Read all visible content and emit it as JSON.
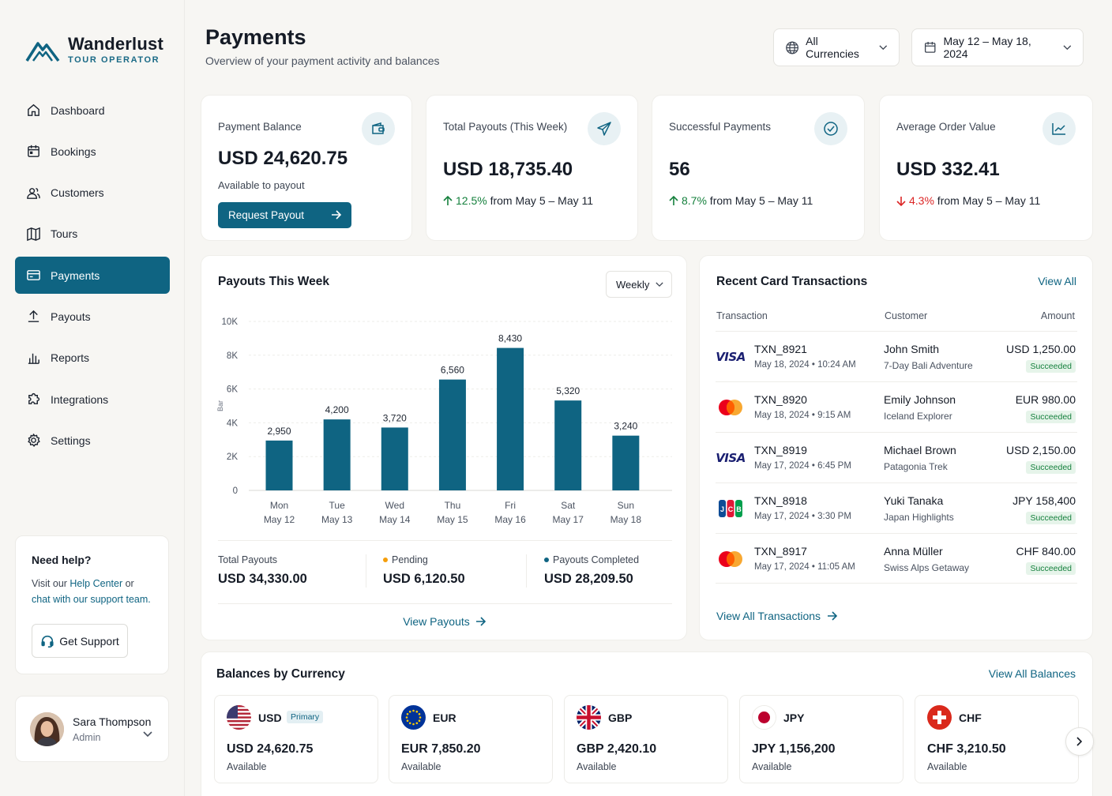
{
  "brand": {
    "name": "Wanderlust",
    "tagline": "TOUR OPERATOR"
  },
  "sidebar": {
    "items": [
      {
        "label": "Dashboard",
        "icon": "home-icon"
      },
      {
        "label": "Bookings",
        "icon": "calendar-icon"
      },
      {
        "label": "Customers",
        "icon": "users-icon"
      },
      {
        "label": "Tours",
        "icon": "map-icon"
      },
      {
        "label": "Payments",
        "icon": "card-icon",
        "active": true
      },
      {
        "label": "Payouts",
        "icon": "upload-icon"
      },
      {
        "label": "Reports",
        "icon": "bar-chart-icon"
      },
      {
        "label": "Integrations",
        "icon": "puzzle-icon"
      },
      {
        "label": "Settings",
        "icon": "gear-icon"
      }
    ],
    "help": {
      "title": "Need help?",
      "text_1": "Visit our ",
      "link_1": "Help Center",
      "text_2": " or ",
      "link_2": "chat with our support team",
      "text_3": ".",
      "button": "Get Support"
    },
    "user": {
      "name": "Sara Thompson",
      "role": "Admin"
    }
  },
  "header": {
    "title": "Payments",
    "subtitle": "Overview of your payment activity and balances",
    "currency_filter": "All Currencies",
    "date_range": "May 12 – May 18, 2024"
  },
  "kpis": {
    "balance": {
      "label": "Payment Balance",
      "value": "USD 24,620.75",
      "sub": "Available to payout",
      "button": "Request Payout"
    },
    "payouts": {
      "label": "Total Payouts (This Week)",
      "value": "USD 18,735.40",
      "change": "12.5%",
      "suffix": " from May 5 – May 11"
    },
    "successful": {
      "label": "Successful Payments",
      "value": "56",
      "change": "8.7%",
      "suffix": " from May 5 – May 11"
    },
    "aov": {
      "label": "Average Order Value",
      "value": "USD 332.41",
      "change": "4.3%",
      "suffix": " from May 5 – May 11"
    }
  },
  "payouts_panel": {
    "title": "Payouts This Week",
    "period": "Weekly",
    "summary": {
      "total_label": "Total Payouts",
      "total_value": "USD 34,330.00",
      "pending_label": "Pending",
      "pending_value": "USD 6,120.50",
      "completed_label": "Payouts Completed",
      "completed_value": "USD 28,209.50"
    },
    "link": "View Payouts"
  },
  "chart_data": {
    "type": "bar",
    "categories": [
      "Mon|May 12",
      "Tue|May 13",
      "Wed|May 14",
      "Thu|May 15",
      "Fri|May 16",
      "Sat|May 17",
      "Sun|May 18"
    ],
    "values": [
      2950,
      4200,
      3720,
      6560,
      8430,
      5320,
      3240
    ],
    "value_labels": [
      "2,950",
      "4,200",
      "3,720",
      "6,560",
      "8,430",
      "5,320",
      "3,240"
    ],
    "yticks": [
      "0",
      "2K",
      "4K",
      "6K",
      "8K",
      "10K"
    ],
    "ylabel": "Bar",
    "ylim": [
      0,
      10000
    ],
    "bar_color": "#0f6482",
    "grid": true
  },
  "transactions": {
    "title": "Recent Card Transactions",
    "view_all": "View All",
    "columns": [
      "Transaction",
      "Customer",
      "Amount"
    ],
    "rows": [
      {
        "brand": "visa-icon",
        "id": "TXN_8921",
        "date": "May 18, 2024",
        "time": "10:24 AM",
        "customer": "John Smith",
        "tour": "7-Day Bali Adventure",
        "amount": "USD 1,250.00",
        "status": "Succeeded"
      },
      {
        "brand": "mastercard-icon",
        "id": "TXN_8920",
        "date": "May 18, 2024",
        "time": "9:15 AM",
        "customer": "Emily Johnson",
        "tour": "Iceland Explorer",
        "amount": "EUR 980.00",
        "status": "Succeeded"
      },
      {
        "brand": "visa-icon",
        "id": "TXN_8919",
        "date": "May 17, 2024",
        "time": "6:45 PM",
        "customer": "Michael Brown",
        "tour": "Patagonia Trek",
        "amount": "USD 2,150.00",
        "status": "Succeeded"
      },
      {
        "brand": "jcb-icon",
        "id": "TXN_8918",
        "date": "May 17, 2024",
        "time": "3:30 PM",
        "customer": "Yuki Tanaka",
        "tour": "Japan Highlights",
        "amount": "JPY 158,400",
        "status": "Succeeded"
      },
      {
        "brand": "mastercard-icon",
        "id": "TXN_8917",
        "date": "May 17, 2024",
        "time": "11:05 AM",
        "customer": "Anna Müller",
        "tour": "Swiss Alps Getaway",
        "amount": "CHF 840.00",
        "status": "Succeeded"
      }
    ],
    "footer_link": "View All Transactions"
  },
  "balances": {
    "title": "Balances by Currency",
    "view_all": "View All Balances",
    "items": [
      {
        "code": "USD",
        "badge": "Primary",
        "value": "USD 24,620.75",
        "sub": "Available",
        "flag": "us-flag-icon"
      },
      {
        "code": "EUR",
        "value": "EUR 7,850.20",
        "sub": "Available",
        "flag": "eu-flag-icon"
      },
      {
        "code": "GBP",
        "value": "GBP 2,420.10",
        "sub": "Available",
        "flag": "uk-flag-icon"
      },
      {
        "code": "JPY",
        "value": "JPY 1,156,200",
        "sub": "Available",
        "flag": "jp-flag-icon"
      },
      {
        "code": "CHF",
        "value": "CHF 3,210.50",
        "sub": "Available",
        "flag": "ch-flag-icon"
      }
    ]
  },
  "colors": {
    "accent": "#0f6482",
    "success": "#15803d",
    "danger": "#dc2626",
    "pending": "#f59e0b"
  }
}
